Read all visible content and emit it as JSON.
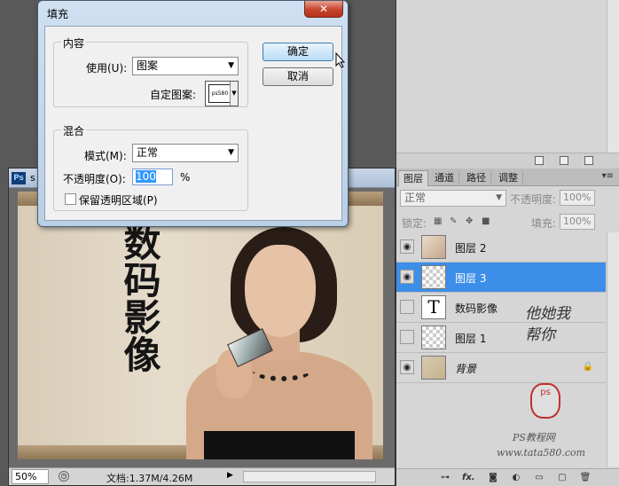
{
  "dialog": {
    "title": "填充",
    "close_label": "✕",
    "contents_group": "内容",
    "use_label": "使用(U):",
    "use_value": "图案",
    "custom_pattern_label": "自定图案:",
    "pattern_thumb_text": "ps580",
    "blending_group": "混合",
    "mode_label": "模式(M):",
    "mode_value": "正常",
    "opacity_label": "不透明度(O):",
    "opacity_value": "100",
    "percent": "%",
    "preserve_label": "保留透明区域(P)",
    "ok": "确定",
    "cancel": "取消"
  },
  "layers_panel": {
    "tabs": [
      "图层",
      "通道",
      "路径",
      "调整"
    ],
    "menu_icon": "▾≡",
    "blend_mode": "正常",
    "opacity_label": "不透明度:",
    "opacity_value": "100%",
    "lock_label": "锁定:",
    "fill_label": "填充:",
    "fill_value": "100%",
    "layers": [
      {
        "name": "图层 2",
        "visible": true,
        "thumb": "photo",
        "selected": false
      },
      {
        "name": "图层 3",
        "visible": true,
        "thumb": "checker",
        "selected": true
      },
      {
        "name": "数码影像",
        "visible": false,
        "thumb": "text",
        "selected": false
      },
      {
        "name": "图层 1",
        "visible": false,
        "thumb": "checker",
        "selected": false
      },
      {
        "name": "背景",
        "visible": true,
        "thumb": "bg",
        "selected": false,
        "locked": true
      }
    ],
    "text_thumb_glyph": "T",
    "bottom_icons": [
      "link-icon",
      "fx-icon",
      "mask-icon",
      "adjustment-icon",
      "group-icon",
      "new-layer-icon",
      "trash-icon"
    ],
    "fx_label": "fx."
  },
  "document": {
    "tab_label": "Ps",
    "name": "s",
    "zoom": "50%",
    "doc_info": "文档:1.37M/4.26M",
    "calligraphy": "数码影像"
  },
  "watermark": {
    "line1": "他她我帮你",
    "seal": "ps",
    "ps_line": "PS教程网",
    "url": "www.tata580.com"
  }
}
